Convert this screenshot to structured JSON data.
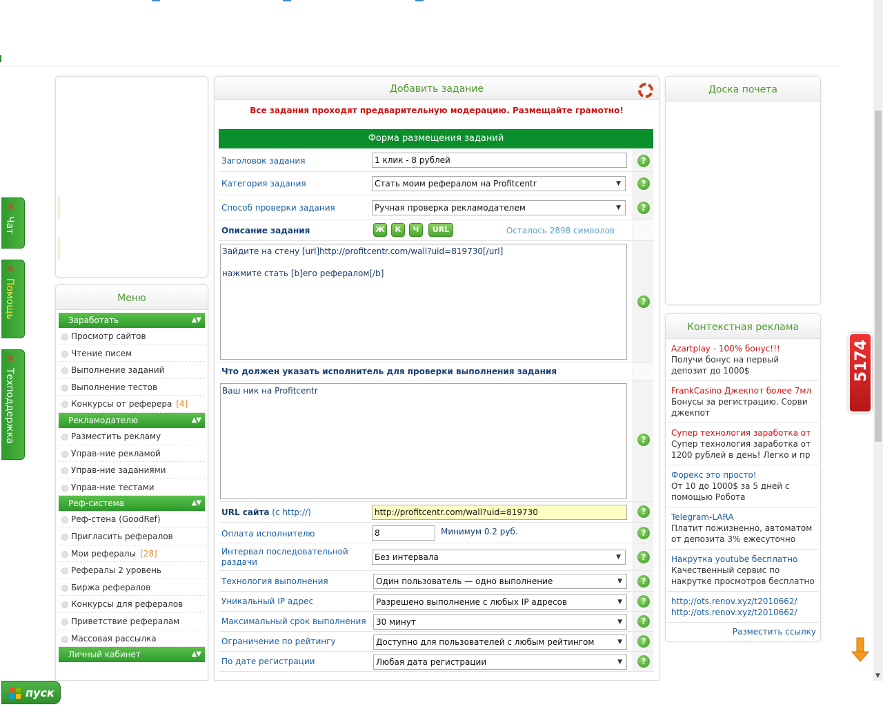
{
  "left_tabs": [
    {
      "label": "Чат"
    },
    {
      "label": "Помощь"
    },
    {
      "label": "Техподдержка"
    }
  ],
  "menu": {
    "title": "Меню",
    "sections": [
      {
        "label": "Заработать",
        "items": [
          {
            "label": "Просмотр сайтов"
          },
          {
            "label": "Чтение писем"
          },
          {
            "label": "Выполнение заданий"
          },
          {
            "label": "Выполнение тестов"
          },
          {
            "label": "Конкурсы от реферера",
            "count": "[4]"
          }
        ]
      },
      {
        "label": "Рекламодателю",
        "items": [
          {
            "label": "Разместить рекламу"
          },
          {
            "label": "Управ-ние рекламой"
          },
          {
            "label": "Управ-ние заданиями"
          },
          {
            "label": "Управ-ние тестами"
          }
        ]
      },
      {
        "label": "Реф-система",
        "items": [
          {
            "label": "Реф-стена (GoodRef)"
          },
          {
            "label": "Пригласить рефералов"
          },
          {
            "label": "Мои рефералы",
            "count": "[28]"
          },
          {
            "label": "Рефералы 2 уровень"
          },
          {
            "label": "Биржа рефералов"
          },
          {
            "label": "Конкурсы для рефералов"
          },
          {
            "label": "Приветствие рефералам"
          },
          {
            "label": "Массовая рассылка"
          }
        ]
      },
      {
        "label": "Личный кабинет",
        "items": []
      }
    ]
  },
  "main": {
    "title": "Добавить задание",
    "notice": "Все задания проходят предварительную модерацию. Размещайте грамотно!",
    "form_title": "Форма размещения заданий",
    "title_label": "Заголовок задания",
    "title_value": "1 клик - 8 рублей",
    "category_label": "Категория задания",
    "category_value": "Стать моим рефералом на Profitcentr",
    "check_label": "Способ проверки задания",
    "check_value": "Ручная проверка рекламодателем",
    "desc_label": "Описание задания",
    "toolbar": {
      "bold": "Ж",
      "italic": "К",
      "underline": "Ч",
      "url": "URL"
    },
    "remaining": "Осталось 2898 символов",
    "desc_line1": "Зайдите на стену [url]http://profitcentr.com/wall?uid=819730[/url]",
    "desc_line2": "нажмите стать [b]его рефералом[/b]",
    "proof_label": "Что должен указать исполнитель для проверки выполнения задания",
    "proof_value": "Ваш ник на Profitcentr",
    "url_label_bold": "URL сайта",
    "url_label_rest": " (с http://)",
    "url_value": "http://profitcentr.com/wall?uid=819730",
    "pay_label": "Оплата исполнителю",
    "pay_value": "8",
    "pay_min": "Минимум 0.2 руб.",
    "interval_label": "Интервал последовательной раздачи",
    "interval_value": "Без интервала",
    "tech_label": "Технология выполнения",
    "tech_value": "Один пользователь — одно выполнение",
    "ip_label": "Уникальный IP адрес",
    "ip_value": "Разрешено выполнение с любых IP адресов",
    "term_label": "Максимальный срок выполнения",
    "term_value": "30 минут",
    "rating_label": "Ограничение по рейтингу",
    "rating_value": "Доступно для пользователей с любым рейтингом",
    "regdate_label": "По дате регистрации",
    "regdate_value": "Любая дата регистрации",
    "help": "?"
  },
  "right": {
    "honor_title": "Доска почета",
    "ads_title": "Контекстная реклама",
    "ads": [
      {
        "title": "Azartplay - 100% бонус!!!",
        "desc": "Получи бонус на первый депозит до 1000$",
        "color": "red"
      },
      {
        "title": "FrankCasino Джекпот более 7мл",
        "desc": "Бонусы за регистрацию. Сорви джекпот",
        "color": "red"
      },
      {
        "title": "Супер технология заработка от",
        "desc": "Супер технология заработка от 1200 рублей в день! Легко и пр",
        "color": "red"
      },
      {
        "title": "Форекс это просто!",
        "desc": "От 10 до 1000$ за 5 дней с помощью Робота",
        "color": "blue"
      },
      {
        "title": "Telegram-LARA",
        "desc": "Платит пожизненно, автоматом от депозита 3% ежесуточно",
        "color": "blue"
      },
      {
        "title": "Накрутка youtube бесплатно",
        "desc": "Качественный сервис по накрутке просмотров бесплатно",
        "color": "blue"
      },
      {
        "title": "http://ots.renov.xyz/t2010662/",
        "desc": "http://ots.renov.xyz/t2010662/",
        "color": "blue"
      }
    ],
    "place_link": "Разместить ссылку"
  },
  "badge": "5174",
  "taskbar": {
    "start": "пуск"
  }
}
